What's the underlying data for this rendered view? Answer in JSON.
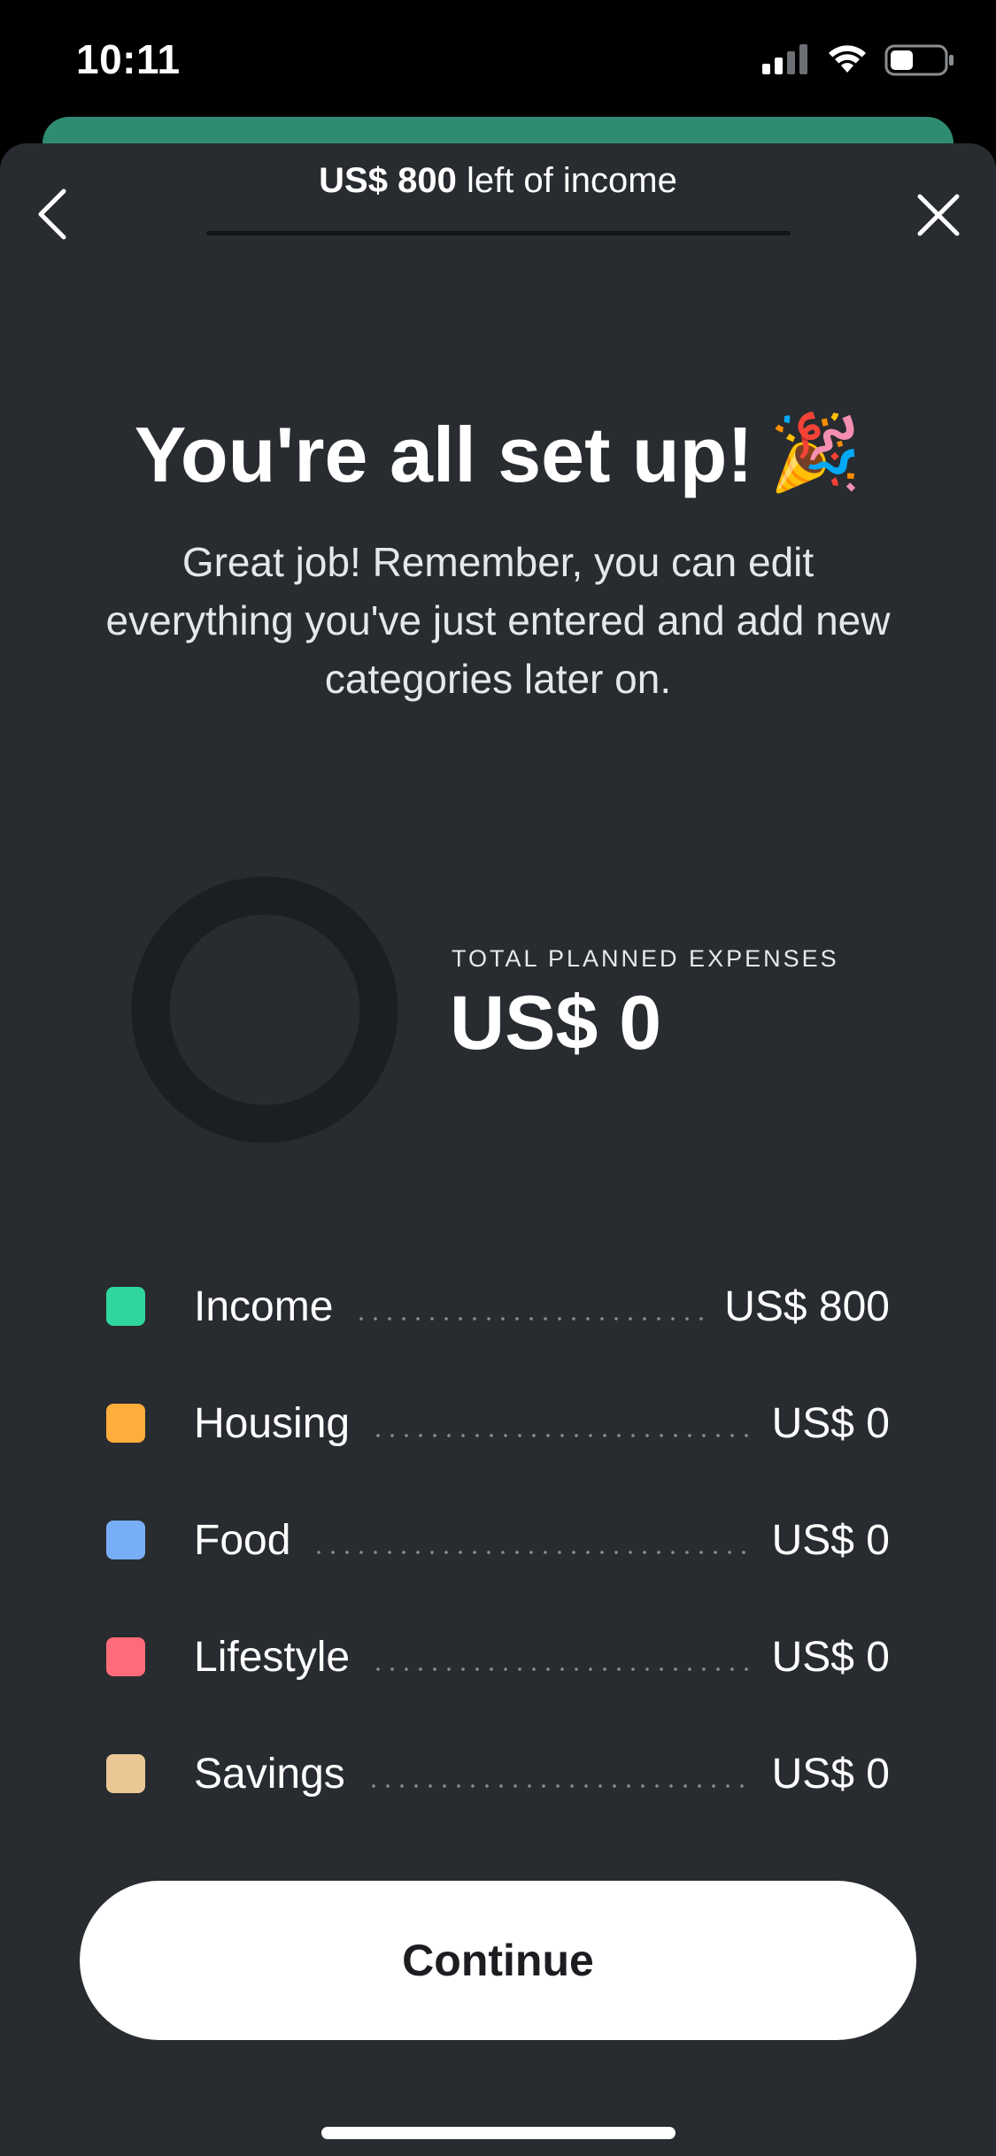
{
  "status_bar": {
    "time": "10:11"
  },
  "header": {
    "amount": "US$ 800",
    "suffix": " left of income"
  },
  "headline": {
    "text": "You're all set up!",
    "emoji": "🎉"
  },
  "subtitle": "Great job! Remember, you can edit everything you've just entered and add new categories later on.",
  "summary": {
    "label": "TOTAL PLANNED EXPENSES",
    "value": "US$ 0"
  },
  "categories": [
    {
      "label": "Income",
      "value": "US$ 800",
      "color": "#2fd69e"
    },
    {
      "label": "Housing",
      "value": "US$ 0",
      "color": "#ffad3b"
    },
    {
      "label": "Food",
      "value": "US$ 0",
      "color": "#78aef5"
    },
    {
      "label": "Lifestyle",
      "value": "US$ 0",
      "color": "#ff6b78"
    },
    {
      "label": "Savings",
      "value": "US$ 0",
      "color": "#ebc796"
    }
  ],
  "continue_button": {
    "label": "Continue"
  },
  "colors": {
    "sheet_background": "#282b2f",
    "accent_green": "#2f8c72",
    "donut_track": "#1c1f22"
  },
  "icons": {
    "back": "chevron-left-icon",
    "close": "close-icon",
    "signal": "cellular-signal-icon",
    "wifi": "wifi-icon",
    "battery": "battery-icon"
  }
}
